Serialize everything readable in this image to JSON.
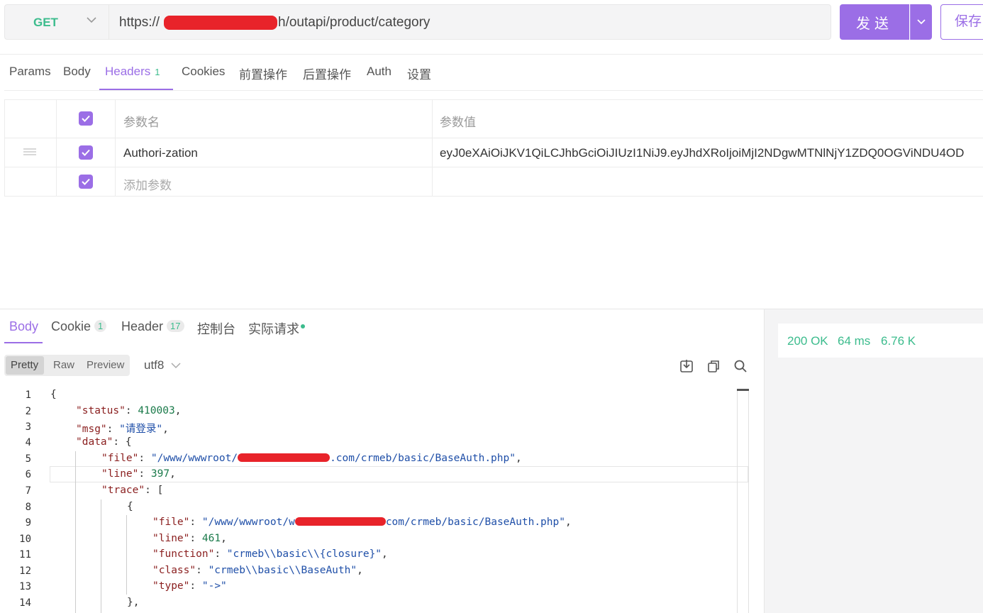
{
  "request": {
    "method": "GET",
    "url_prefix": "https://",
    "url_suffix": "h/outapi/product/category",
    "send_label": "发送",
    "save_label": "保存"
  },
  "request_tabs": [
    {
      "label": "Params"
    },
    {
      "label": "Body"
    },
    {
      "label": "Headers",
      "count": "1"
    },
    {
      "label": "Cookies"
    },
    {
      "label": "前置操作"
    },
    {
      "label": "后置操作"
    },
    {
      "label": "Auth"
    },
    {
      "label": "设置"
    }
  ],
  "headers_table": {
    "col_name": "参数名",
    "col_value": "参数值",
    "rows": [
      {
        "name": "Authori-zation",
        "value": "eyJ0eXAiOiJKV1QiLCJhbGciOiJIUzI1NiJ9.eyJhdXRoIjoiMjI2NDgwMTNlNjY1ZDQ0OGViNDU4OD",
        "checked": true
      }
    ],
    "add_placeholder": "添加参数"
  },
  "response_tabs": [
    {
      "label": "Body"
    },
    {
      "label": "Cookie",
      "count": "1"
    },
    {
      "label": "Header",
      "count": "17"
    },
    {
      "label": "控制台"
    },
    {
      "label": "实际请求"
    }
  ],
  "status": {
    "code": "200 OK",
    "time": "64 ms",
    "size": "6.76 K"
  },
  "view_modes": [
    "Pretty",
    "Raw",
    "Preview"
  ],
  "encoding": "utf8",
  "code": {
    "line_numbers": [
      "1",
      "2",
      "3",
      "4",
      "5",
      "6",
      "7",
      "8",
      "9",
      "10",
      "11",
      "12",
      "13",
      "14"
    ],
    "status_key": "\"status\"",
    "status_val": "410003",
    "msg_key": "\"msg\"",
    "msg_val": "\"请登录\"",
    "data_key": "\"data\"",
    "file_key": "\"file\"",
    "file_val_start": "\"/www/wwwroot/",
    "file_val_end": ".com/crmeb/basic/BaseAuth.php\"",
    "line_key": "\"line\"",
    "line_val": "397",
    "trace_key": "\"trace\"",
    "t_file_key": "\"file\"",
    "t_file_val_start": "\"/www/wwwroot/w",
    "t_file_val_end": "com/crmeb/basic/BaseAuth.php\"",
    "t_line_key": "\"line\"",
    "t_line_val": "461",
    "t_func_key": "\"function\"",
    "t_func_val": "\"crmeb\\\\basic\\\\{closure}\"",
    "t_class_key": "\"class\"",
    "t_class_val": "\"crmeb\\\\basic\\\\BaseAuth\"",
    "t_type_key": "\"type\"",
    "t_type_val": "\"->\""
  },
  "colors": {
    "accent": "#9b6ee6",
    "success": "#3cbc8d",
    "redaction": "#e8232a"
  }
}
